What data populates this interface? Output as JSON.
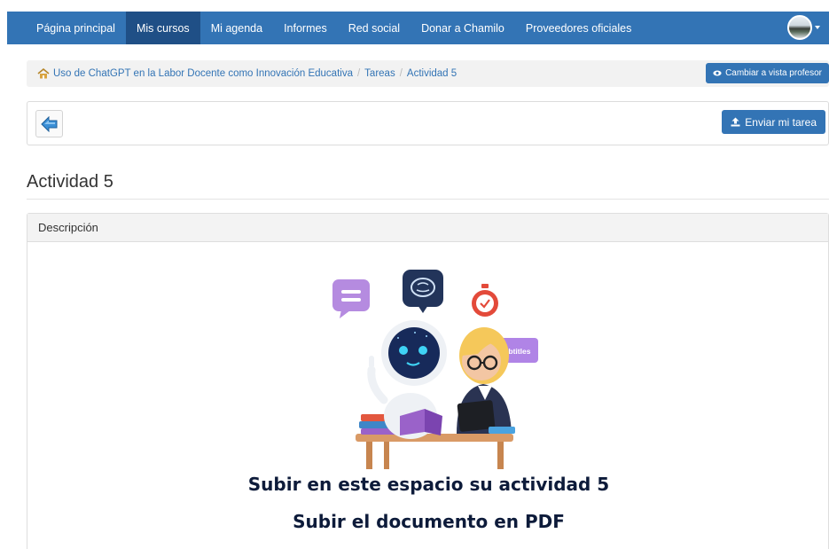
{
  "navbar": {
    "items": [
      {
        "label": "Página principal"
      },
      {
        "label": "Mis cursos"
      },
      {
        "label": "Mi agenda"
      },
      {
        "label": "Informes"
      },
      {
        "label": "Red social"
      },
      {
        "label": "Donar a Chamilo"
      },
      {
        "label": "Proveedores oficiales"
      }
    ],
    "active_index": 1
  },
  "breadcrumb": {
    "items": [
      {
        "label": "Uso de ChatGPT en la Labor Docente como Innovación Educativa"
      },
      {
        "label": "Tareas"
      },
      {
        "label": "Actividad 5"
      }
    ],
    "switch_view_label": "Cambiar a vista profesor"
  },
  "toolbar": {
    "submit_label": "Enviar mi tarea"
  },
  "page": {
    "title": "Actividad 5"
  },
  "panel": {
    "heading": "Descripción",
    "illustration_badge": "Subtitles",
    "line1": "Subir en este espacio su actividad 5",
    "line2": "Subir el documento en PDF"
  },
  "colors": {
    "brand_blue": "#3374b5",
    "nav_active": "#1f4f86",
    "text_navy": "#0d1b3a"
  },
  "icons": {
    "home": "home-icon",
    "eye": "eye-icon",
    "back": "back-arrow-icon",
    "upload": "upload-icon",
    "avatar": "user-avatar"
  }
}
